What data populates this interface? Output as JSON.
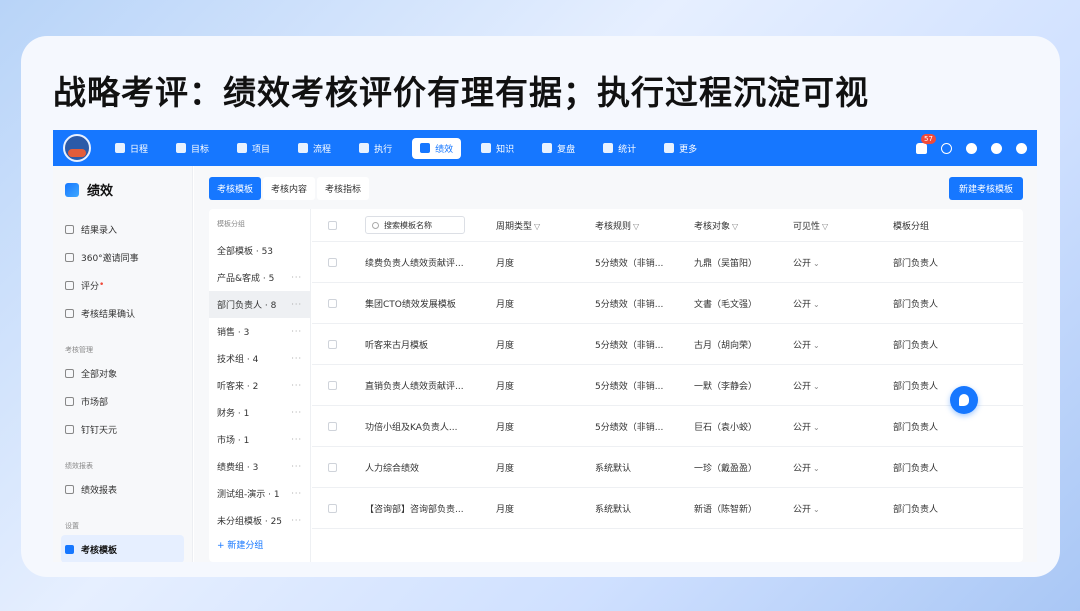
{
  "headline": "战略考评：绩效考核评价有理有据；执行过程沉淀可视",
  "nav": {
    "items": [
      {
        "label": "日程",
        "icon": "calendar-icon"
      },
      {
        "label": "目标",
        "icon": "target-icon"
      },
      {
        "label": "项目",
        "icon": "project-icon"
      },
      {
        "label": "流程",
        "icon": "flow-icon"
      },
      {
        "label": "执行",
        "icon": "execute-icon"
      },
      {
        "label": "绩效",
        "icon": "performance-icon",
        "active": true
      },
      {
        "label": "知识",
        "icon": "book-icon"
      },
      {
        "label": "复盘",
        "icon": "review-icon"
      },
      {
        "label": "统计",
        "icon": "pie-chart-icon"
      },
      {
        "label": "更多",
        "icon": "grid-icon"
      }
    ],
    "notification_count": "57"
  },
  "sidebar": {
    "title": "绩效",
    "items_top": [
      {
        "label": "结果录入",
        "icon": "edit-icon"
      },
      {
        "label": "360°邀请同事",
        "icon": "invite-icon"
      },
      {
        "label": "评分",
        "icon": "score-icon",
        "marker": "•"
      },
      {
        "label": "考核结果确认",
        "icon": "confirm-icon"
      }
    ],
    "group_manage": "考核管理",
    "items_manage": [
      {
        "label": "全部对象",
        "icon": "grid-icon"
      },
      {
        "label": "市场部",
        "icon": "department-icon"
      },
      {
        "label": "钉钉天元",
        "icon": "department-icon"
      }
    ],
    "group_report": "绩效报表",
    "items_report": [
      {
        "label": "绩效报表",
        "icon": "report-icon"
      }
    ],
    "group_settings": "设置",
    "active_item": {
      "label": "考核模板",
      "icon": "template-icon"
    }
  },
  "tabs": [
    "考核模板",
    "考核内容",
    "考核指标"
  ],
  "new_button": "新建考核模板",
  "groups": {
    "title": "模板分组",
    "items": [
      {
        "label": "全部模板 · 53",
        "more": ""
      },
      {
        "label": "产品&客成 · 5",
        "more": "···"
      },
      {
        "label": "部门负责人 · 8",
        "more": "···"
      },
      {
        "label": "销售 · 3",
        "more": "···"
      },
      {
        "label": "技术组 · 4",
        "more": "···"
      },
      {
        "label": "听客来 · 2",
        "more": "···"
      },
      {
        "label": "财务 · 1",
        "more": "···"
      },
      {
        "label": "市场 · 1",
        "more": "···"
      },
      {
        "label": "绩费组 · 3",
        "more": "···"
      },
      {
        "label": "测试组-演示 · 1",
        "more": "···"
      },
      {
        "label": "未分组模板 · 25",
        "more": "···"
      }
    ],
    "add_label": "+ 新建分组"
  },
  "table": {
    "search_placeholder": "搜索模板名称",
    "columns": [
      "周期类型",
      "考核规则",
      "考核对象",
      "可见性",
      "模板分组"
    ],
    "filter_glyph": "▽",
    "rows": [
      {
        "name": "续费负责人绩效贡献评...",
        "cycle": "月度",
        "rule": "5分绩效（非销...",
        "target": "九鼎（吴笛阳）",
        "visibility": "公开",
        "group": "部门负责人"
      },
      {
        "name": "集团CTO绩效发展模板",
        "cycle": "月度",
        "rule": "5分绩效（非销...",
        "target": "文書（毛文强）",
        "visibility": "公开",
        "group": "部门负责人"
      },
      {
        "name": "听客来古月模板",
        "cycle": "月度",
        "rule": "5分绩效（非销...",
        "target": "古月（胡向荣）",
        "visibility": "公开",
        "group": "部门负责人"
      },
      {
        "name": "直销负责人绩效贡献评...",
        "cycle": "月度",
        "rule": "5分绩效（非销...",
        "target": "一默（李静会）",
        "visibility": "公开",
        "group": "部门负责人"
      },
      {
        "name": "功倍小组及KA负责人...",
        "cycle": "月度",
        "rule": "5分绩效（非销...",
        "target": "巨石（袁小蛟）",
        "visibility": "公开",
        "group": "部门负责人"
      },
      {
        "name": "人力综合绩效",
        "cycle": "月度",
        "rule": "系统默认",
        "target": "一珍（戴盈盈）",
        "visibility": "公开",
        "group": "部门负责人"
      },
      {
        "name": "【咨询部】咨询部负责...",
        "cycle": "月度",
        "rule": "系统默认",
        "target": "新语（陈智新）",
        "visibility": "公开",
        "group": "部门负责人"
      }
    ],
    "dropdown_glyph": "⌄"
  }
}
